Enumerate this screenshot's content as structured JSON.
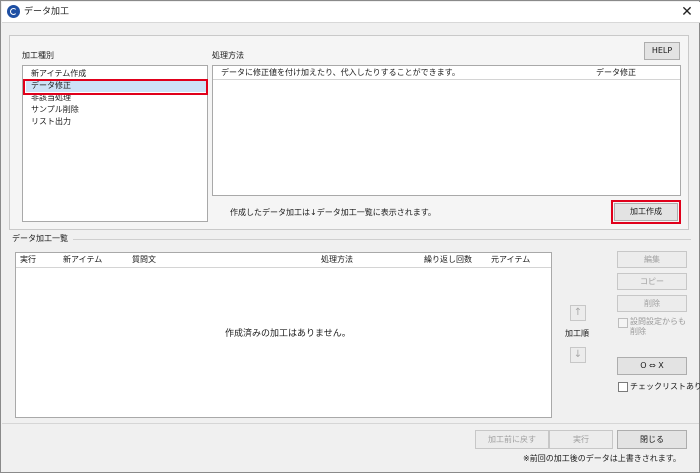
{
  "window": {
    "title": "データ加工",
    "close_glyph": "✕"
  },
  "processing": {
    "type_label": "加工種別",
    "method_label": "処理方法",
    "help_label": "HELP",
    "types": [
      {
        "label": "新アイテム作成",
        "selected": false
      },
      {
        "label": "データ修正",
        "selected": true
      },
      {
        "label": "非該当処理",
        "selected": false
      },
      {
        "label": "サンプル削除",
        "selected": false
      },
      {
        "label": "リスト出力",
        "selected": false
      }
    ],
    "method_description": "データに修正値を付け加えたり、代入したりすることができます。",
    "method_name": "データ修正",
    "hint_text": "作成したデータ加工は↓データ加工一覧に表示されます。",
    "create_button": "加工作成"
  },
  "list_section": {
    "title": "データ加工一覧",
    "columns": [
      "実行",
      "新アイテム",
      "質問文",
      "処理方法",
      "繰り返し回数",
      "元アイテム"
    ],
    "empty_message": "作成済みの加工はありません。",
    "order_label": "加工順",
    "up_glyph": "↑",
    "down_glyph": "↓"
  },
  "side_buttons": {
    "edit": "編集",
    "copy": "コピー",
    "delete": "削除",
    "delete_from_settings_line1": "設問設定からも",
    "delete_from_settings_line2": "削除",
    "ox_button": "O ⇔ X",
    "checklist_label": "チェックリストあり"
  },
  "footer": {
    "undo": "加工前に戻す",
    "execute": "実行",
    "close": "閉じる",
    "note": "※前回の加工後のデータは上書きされます。"
  },
  "colors": {
    "highlight_red": "#e0001b",
    "selection_blue": "#cde2f7"
  }
}
